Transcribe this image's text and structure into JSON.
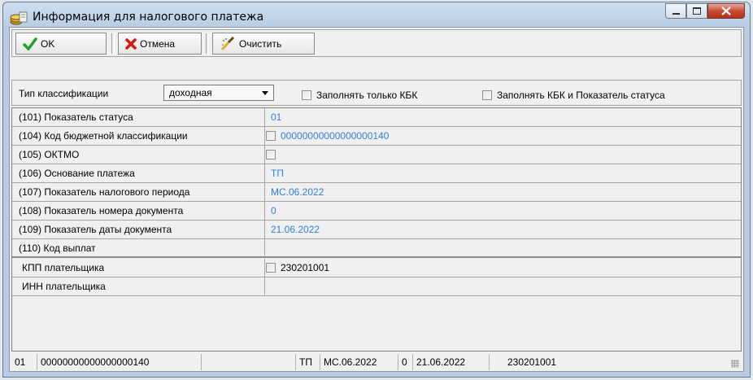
{
  "window": {
    "title": "Информация для налогового платежа"
  },
  "toolbar": {
    "ok_label": "OK",
    "cancel_label": "Отмена",
    "clear_label": "Очистить"
  },
  "filter": {
    "type_label": "Тип классификации",
    "type_value": "доходная",
    "only_kbk_label": "Заполнять только КБК",
    "kbk_and_status_label": "Заполнять КБК и Показатель статуса"
  },
  "fields": [
    {
      "label": "(101) Показатель статуса",
      "value": "01"
    },
    {
      "label": "(104) Код бюджетной классификации",
      "value": "00000000000000000140",
      "has_checkbox": true
    },
    {
      "label": "(105) ОКТМО",
      "value": "",
      "has_checkbox": true
    },
    {
      "label": "(106) Основание платежа",
      "value": "ТП"
    },
    {
      "label": "(107) Показатель налогового периода",
      "value": "МС.06.2022"
    },
    {
      "label": "(108) Показатель номера документа",
      "value": "0"
    },
    {
      "label": "(109) Показатель даты документа",
      "value": "21.06.2022"
    },
    {
      "label": "(110) Код выплат",
      "value": ""
    },
    {
      "label": "КПП плательщика",
      "value": "230201001",
      "has_checkbox": true
    },
    {
      "label": "ИНН плательщика",
      "value": ""
    }
  ],
  "statusbar": {
    "status": "01",
    "kbk": "00000000000000000140",
    "basis": "ТП",
    "period": "МС.06.2022",
    "doc_number": "0",
    "doc_date": "21.06.2022",
    "kpp": "230201001"
  },
  "colors": {
    "value_text": "#2f7fd9",
    "close_button": "#c94a35"
  }
}
